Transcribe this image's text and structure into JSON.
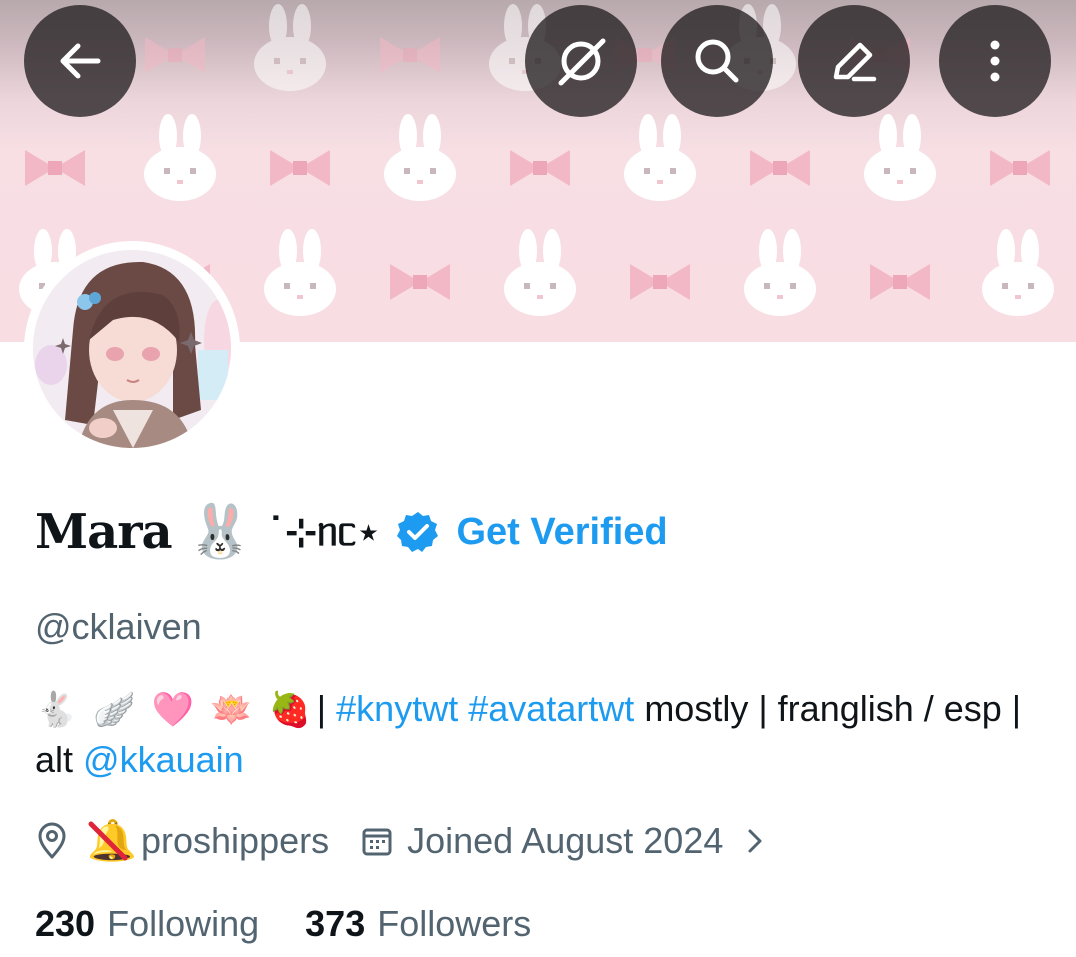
{
  "header": {
    "back_icon": "arrow-left-icon",
    "grok_icon": "grok-icon",
    "search_icon": "search-icon",
    "edit_icon": "edit-pen-icon",
    "more_icon": "more-vertical-icon"
  },
  "profile": {
    "display_name": "Mara",
    "name_emoji": "🐰",
    "name_decoration": "˙⊹ᥒᥴ⋆",
    "get_verified": "Get Verified",
    "handle": "@cklaiven",
    "bio": {
      "emojis": [
        "🐇",
        "🪽",
        "🩷",
        "🪷",
        "🍓"
      ],
      "separator_1": "|",
      "hashtag_1": "#knytwt",
      "hashtag_2": "#avatartwt",
      "text_1": "mostly | franglish / esp | alt",
      "mention": "@kkauain"
    },
    "location_emoji": "🔔",
    "location": "proshippers",
    "joined": "Joined August 2024",
    "following_count": "230",
    "following_label": "Following",
    "followers_count": "373",
    "followers_label": "Followers"
  },
  "colors": {
    "accent": "#1d9bf0",
    "text_primary": "#0f1419",
    "text_secondary": "#536471",
    "banner_pink": "#f8dde3"
  }
}
